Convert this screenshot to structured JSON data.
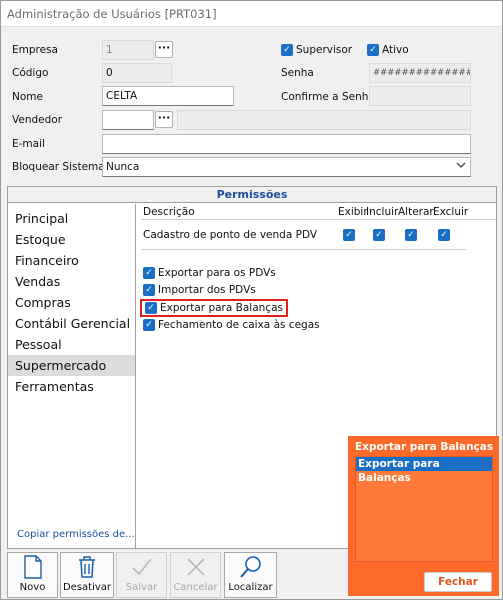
{
  "window": {
    "title": "Administração de Usuários [PRT031]"
  },
  "form": {
    "empresa_label": "Empresa",
    "empresa_value": "1",
    "codigo_label": "Código",
    "codigo_value": "0",
    "nome_label": "Nome",
    "nome_value": "CELTA",
    "vendedor_label": "Vendedor",
    "vendedor_value": "",
    "email_label": "E-mail",
    "email_value": "",
    "bloquear_label": "Bloquear Sistema",
    "bloquear_value": "Nunca",
    "supervisor_label": "Supervisor",
    "ativo_label": "Ativo",
    "senha_label": "Senha",
    "senha_value": "################",
    "confirme_label": "Confirme a Senha",
    "confirme_value": "",
    "dots": "···"
  },
  "permissions": {
    "title": "Permissões",
    "modules": [
      "Principal",
      "Estoque",
      "Financeiro",
      "Vendas",
      "Compras",
      "Contábil Gerencial",
      "Pessoal",
      "Supermercado",
      "Ferramentas"
    ],
    "selected_module": "Supermercado",
    "copy_link": "Copiar permissões de...",
    "columns": {
      "descricao": "Descrição",
      "exibir": "Exibir",
      "incluir": "Incluir",
      "alterar": "Alterar",
      "excluir": "Excluir"
    },
    "row": {
      "description": "Cadastro de ponto de venda  PDV",
      "exibir": true,
      "incluir": true,
      "alterar": true,
      "excluir": true
    },
    "checks": [
      {
        "label": "Exportar para os PDVs",
        "checked": true
      },
      {
        "label": "Importar dos PDVs",
        "checked": true
      },
      {
        "label": "Exportar para Balanças",
        "checked": true,
        "highlighted": true
      },
      {
        "label": "Fechamento de caixa às cegas",
        "checked": true
      }
    ]
  },
  "toolbar": {
    "novo": "Novo",
    "desativar": "Desativar",
    "salvar": "Salvar",
    "cancelar": "Cancelar",
    "localizar": "Localizar"
  },
  "popup": {
    "title": "Exportar para Balanças",
    "item": "Exportar para Balanças",
    "close": "Fechar"
  },
  "colors": {
    "accent": "#1a6fc4",
    "popup": "#ff6a2b",
    "highlight": "#e02020"
  }
}
